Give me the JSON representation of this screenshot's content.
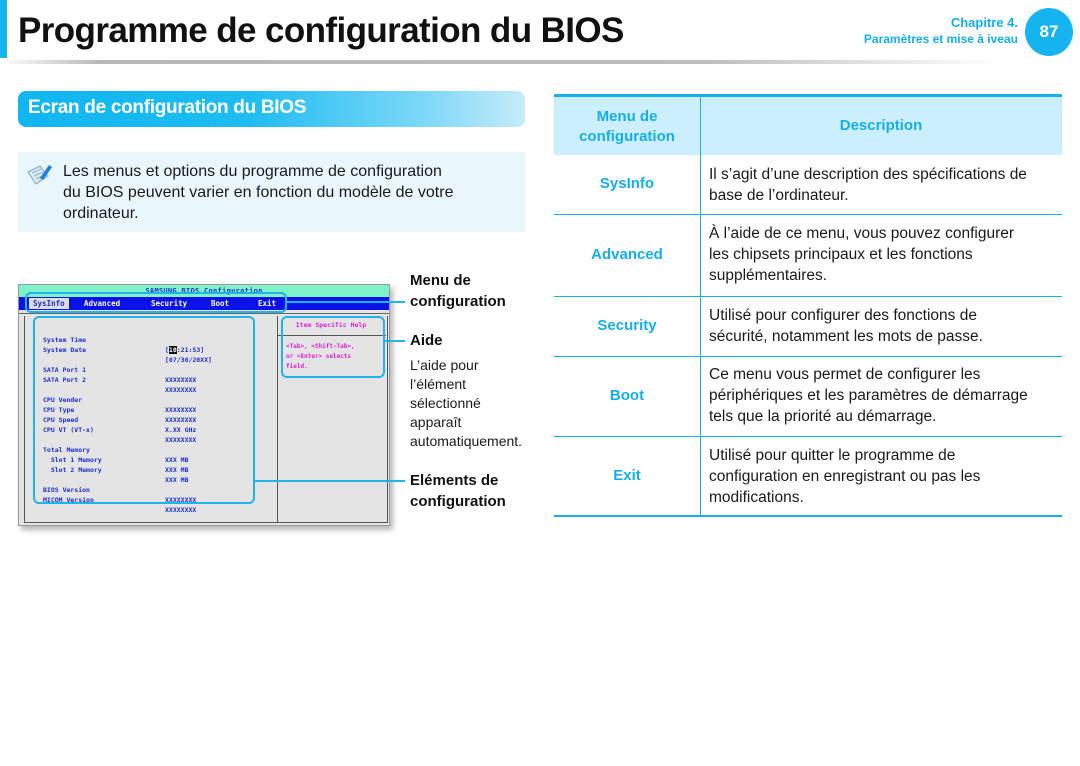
{
  "header": {
    "title": "Programme de configuration du BIOS",
    "chapter_label": "Chapitre 4.",
    "chapter_title": "Paramètres et mise à iveau",
    "page_number": "87",
    "accent_color": "#15b4ef"
  },
  "section": {
    "heading": "Ecran de configuration du BIOS"
  },
  "note": {
    "icon": "note-pencil-icon",
    "lines": [
      "Les menus et options du programme de configuration",
      "du BIOS peuvent varier en fonction du modèle de votre",
      "ordinateur."
    ]
  },
  "bios_screen": {
    "title": "SAMSUNG BIOS Configuration",
    "menu": [
      "SysInfo",
      "Advanced",
      "Security",
      "Boot",
      "Exit"
    ],
    "selected_menu": "SysInfo",
    "help_title": "Item Specific Help",
    "help_text": "<Tab>, <Shift-Tab>,\nor <Enter> selects\nfield.",
    "items": [
      {
        "label": "System Time",
        "value_prefix": "[",
        "value_highlight": "10",
        "value_suffix": ":21:53]"
      },
      {
        "label": "System Date",
        "value": "[07/30/20XX]"
      },
      {
        "label": "SATA Port 1",
        "value": "XXXXXXXX"
      },
      {
        "label": "SATA Port 2",
        "value": "XXXXXXXX"
      },
      {
        "label": "CPU Vender",
        "value": "XXXXXXXX"
      },
      {
        "label": "CPU Type",
        "value": "XXXXXXXX"
      },
      {
        "label": "CPU Speed",
        "value": "X.XX GHz"
      },
      {
        "label": "CPU VT (VT-x)",
        "value": "XXXXXXXX"
      },
      {
        "label": "Total Memory",
        "value": "XXX MB"
      },
      {
        "label": "  Slot 1 Memory",
        "value": "XXX MB"
      },
      {
        "label": "  Slot 2 Memory",
        "value": "XXX MB"
      },
      {
        "label": "BIOS Version",
        "value": "XXXXXXXX"
      },
      {
        "label": "MICOM Version",
        "value": "XXXXXXXX"
      }
    ]
  },
  "callouts": {
    "menu_label_1": "Menu de",
    "menu_label_2": "configuration",
    "help_label": "Aide",
    "help_desc": [
      "L’aide pour",
      "l’élément",
      "sélectionné",
      "apparaît",
      "automatiquement."
    ],
    "items_label_1": "Eléments de",
    "items_label_2": "configuration"
  },
  "table": {
    "header_menu_1": "Menu de",
    "header_menu_2": "configuration",
    "header_desc": "Description",
    "rows": [
      {
        "menu": "SysInfo",
        "desc": [
          "Il s’agit d’une description des spécifications de",
          "base de l’ordinateur."
        ]
      },
      {
        "menu": "Advanced",
        "desc": [
          "À l’aide de ce menu, vous pouvez configurer",
          "les chipsets principaux et les fonctions",
          "supplémentaires."
        ]
      },
      {
        "menu": "Security",
        "desc": [
          "Utilisé pour configurer des fonctions de",
          "sécurité, notamment les mots de passe."
        ]
      },
      {
        "menu": "Boot",
        "desc": [
          "Ce menu vous permet de configurer les",
          "périphériques et les paramètres de démarrage",
          "tels que la priorité au démarrage."
        ]
      },
      {
        "menu": "Exit",
        "desc": [
          "Utilisé pour quitter le programme de",
          "configuration en enregistrant ou pas les",
          "modifications."
        ]
      }
    ]
  }
}
